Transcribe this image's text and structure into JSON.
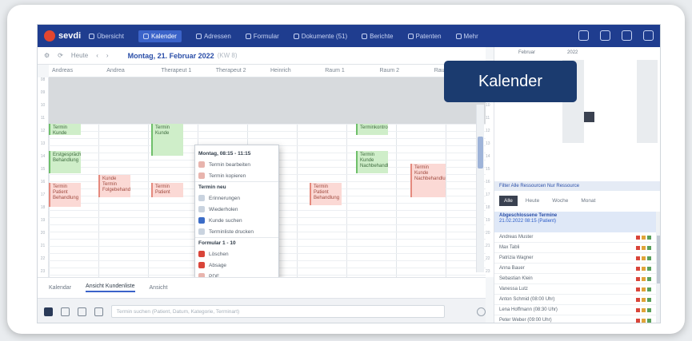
{
  "badge": {
    "label": "Kalender"
  },
  "topnav": {
    "brand": "sevdi",
    "items": [
      {
        "label": "Übersicht",
        "active": false
      },
      {
        "label": "Kalender",
        "active": true
      },
      {
        "label": "Adressen",
        "active": false
      },
      {
        "label": "Formular",
        "active": false
      },
      {
        "label": "Dokumente (51)",
        "active": false
      },
      {
        "label": "Berichte",
        "active": false
      },
      {
        "label": "Patenten",
        "active": false
      },
      {
        "label": "Mehr",
        "active": false
      }
    ]
  },
  "toolbar": {
    "today": "Heute",
    "date_title": "Montag, 21. Februar 2022",
    "date_sub": "(KW 8)"
  },
  "columns": [
    "Andreas",
    "Andrea",
    "Therapeut 1",
    "Therapeut 2",
    "Heinrich",
    "Raum 1",
    "Raum 2",
    "Raum 3"
  ],
  "times": [
    "08",
    "",
    "09",
    "",
    "10",
    "",
    "11",
    "",
    "12",
    "",
    "13",
    "",
    "14",
    "",
    "15",
    "",
    "16",
    "",
    "17",
    "",
    "18",
    "",
    "19",
    "",
    "20",
    "",
    "21",
    "",
    "22",
    "",
    "23"
  ],
  "events": [
    {
      "text": "Termin Kunde",
      "color": "green"
    },
    {
      "text": "Erstgespräch Behandlung",
      "color": "green"
    },
    {
      "text": "Termin Kunde",
      "color": "green"
    },
    {
      "text": "Terminkontrolle",
      "color": "green"
    },
    {
      "text": "Termin Kunde Nachbehandlung",
      "color": "green"
    },
    {
      "text": "Termin Kunde Nachbehandlung",
      "color": "red"
    },
    {
      "text": "Kunde Termin Folgebehandlung",
      "color": "red"
    },
    {
      "text": "Termin Patient Behandlung",
      "color": "red"
    },
    {
      "text": "Termin Patient",
      "color": "red"
    },
    {
      "text": "Termin Patient Behandlung",
      "color": "red"
    }
  ],
  "context_menu": {
    "title": "Montag, 08:15 - 11:15",
    "items": [
      {
        "label": "Termin bearbeiten",
        "icon": "edit-icon",
        "kind": "pdf"
      },
      {
        "label": "Termin kopieren",
        "icon": "copy-icon",
        "kind": "pdf"
      },
      {
        "label": "Termin neu",
        "icon": "",
        "kind": "header",
        "sep": true
      },
      {
        "label": "Erinnerungen",
        "icon": "bell-icon",
        "kind": "normal"
      },
      {
        "label": "Wiederholen",
        "icon": "repeat-icon",
        "kind": "normal"
      },
      {
        "label": "Kunde suchen",
        "icon": "user-icon",
        "kind": "blue"
      },
      {
        "label": "Terminliste drucken",
        "icon": "print-icon",
        "kind": "normal"
      },
      {
        "label": "Formular 1 - 10",
        "icon": "",
        "kind": "header",
        "sep": true
      },
      {
        "label": "Löschen",
        "icon": "delete-icon",
        "kind": "red"
      },
      {
        "label": "Absage",
        "icon": "cancel-icon",
        "kind": "red"
      },
      {
        "label": "PDF",
        "icon": "pdf-icon",
        "kind": "pdf"
      }
    ]
  },
  "bottom_tabs": [
    {
      "label": "Kalendar",
      "active": false
    },
    {
      "label": "Ansicht Kundenliste",
      "active": true
    },
    {
      "label": "Ansicht",
      "active": false
    }
  ],
  "bottom_bar": {
    "search_placeholder": "Termin suchen (Patient, Datum, Kategorie, Terminart)"
  },
  "right_panel": {
    "month_label": "Februar",
    "year_label": "2022",
    "filter_text": "Filter Alle Ressourcen Nur Ressource",
    "tabs": [
      "Alle",
      "Heute",
      "Woche",
      "Monat"
    ],
    "selected": {
      "title": "Abgeschlossene Termine",
      "sub": "21.02.2022 08:15 (Patient)"
    },
    "list": [
      "Andreas Muster",
      "Max Tabli",
      "Patrizia Wagner",
      "Anna Bauer",
      "Sebastian Klein",
      "Vanessa Lutz",
      "Anton Schmid (08:00 Uhr)",
      "Lena Hoffmann (08:30 Uhr)",
      "Peter Weber (09:00 Uhr)"
    ]
  }
}
